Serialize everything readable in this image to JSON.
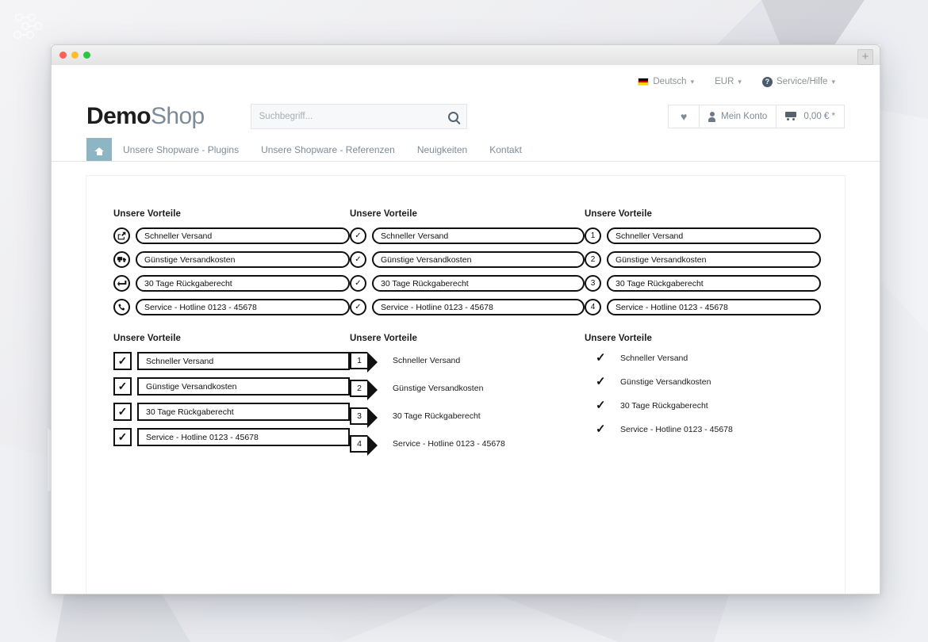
{
  "window": {
    "traffic_lights": [
      "red",
      "yellow",
      "green"
    ],
    "new_tab_label": "+"
  },
  "watermark": {
    "name": "shopware-nodes-logo"
  },
  "topbar": {
    "language": {
      "label": "Deutsch",
      "flag": "german-flag",
      "caret": "⌄"
    },
    "currency": {
      "label": "EUR",
      "caret": "⌄"
    },
    "service": {
      "label": "Service/Hilfe",
      "icon_char": "?",
      "caret": "⌄"
    }
  },
  "header": {
    "logo_bold": "Demo",
    "logo_light": "Shop",
    "search": {
      "value": "",
      "placeholder": "Suchbegriff..."
    },
    "actions": {
      "wishlist_icon": "♥",
      "account_label": "Mein Konto",
      "cart_label": "0,00 € *"
    }
  },
  "nav": {
    "home_title": "Home",
    "items": [
      {
        "label": "Unsere Shopware - Plugins"
      },
      {
        "label": "Unsere Shopware - Referenzen"
      },
      {
        "label": "Neuigkeiten"
      },
      {
        "label": "Kontakt"
      }
    ]
  },
  "benefits": {
    "heading": "Unsere Vorteile",
    "items": [
      "Schneller Versand",
      "Günstige Versandkosten",
      "30 Tage Rückgaberecht",
      "Service - Hotline 0123 - 45678"
    ],
    "numbers": [
      "1",
      "2",
      "3",
      "4"
    ],
    "check_char": "✓",
    "icons": [
      "export-icon",
      "truck-icon",
      "return-arrow-icon",
      "phone-icon"
    ]
  },
  "blocks": [
    {
      "id": "icons-pill",
      "heading": "Unsere Vorteile",
      "style": "circle-icon + pill"
    },
    {
      "id": "checks-pill",
      "heading": "Unsere Vorteile",
      "style": "circle-check + pill"
    },
    {
      "id": "numbers-pill",
      "heading": "Unsere Vorteile",
      "style": "circle-number + pill"
    },
    {
      "id": "checks-square",
      "heading": "Unsere Vorteile",
      "style": "square-check + bar"
    },
    {
      "id": "numbers-arrow",
      "heading": "Unsere Vorteile",
      "style": "number-flag + text"
    },
    {
      "id": "checks-plain",
      "heading": "Unsere Vorteile",
      "style": "plain-check + text"
    }
  ],
  "colors": {
    "accent": "#8EB5C3",
    "ink": "#111111",
    "muted": "#7d8b97",
    "page_bg": "#e9eaee"
  }
}
